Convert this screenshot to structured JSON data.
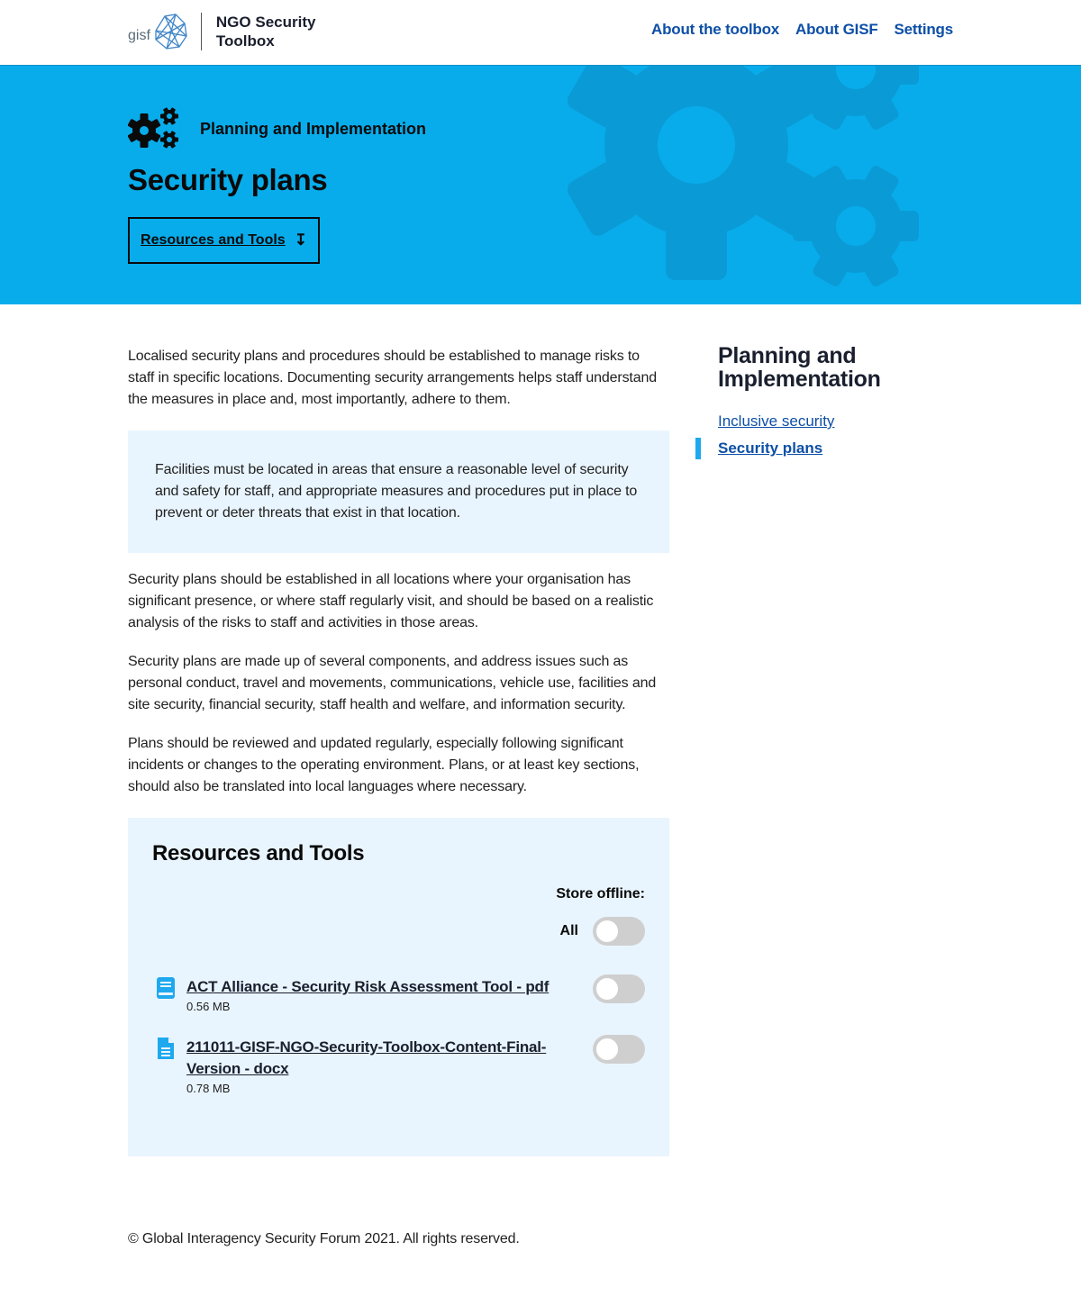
{
  "header": {
    "logo_text": "gisf",
    "site_title": "NGO Security Toolbox",
    "nav": [
      {
        "label": "About the toolbox"
      },
      {
        "label": "About GISF"
      },
      {
        "label": "Settings"
      }
    ]
  },
  "hero": {
    "category_icon": "gears-icon",
    "category": "Planning and Implementation",
    "title": "Security plans",
    "button_label": "Resources and Tools",
    "button_icon": "arrow-down-icon",
    "background_color": "#08aceb"
  },
  "main": {
    "intro": " Localised security plans and procedures should be established to manage risks to staff in specific locations.  Documenting security arrangements helps staff understand the measures in place and, most importantly, adhere to them.",
    "callout": "Facilities must be located in areas that ensure a reasonable level of security and safety for staff, and appropriate measures and procedures put in place to prevent or deter threats that exist in that location.",
    "paragraphs": [
      "Security plans should be established in all locations where your organisation has significant presence, or where staff regularly visit, and should be based on a realistic analysis of the risks to staff and activities in those areas.",
      " Security plans are made up of several components, and address issues such as personal conduct, travel and movements, communications, vehicle use, facilities and site security, financial security, staff health and welfare, and information security.",
      " Plans should be reviewed and updated regularly, especially following significant incidents or changes to the operating environment. Plans, or at least key sections, should also be translated into local languages where necessary."
    ]
  },
  "resources": {
    "title": "Resources and Tools",
    "store_offline_label": "Store offline:",
    "all_label": "All",
    "all_toggle_on": false,
    "items": [
      {
        "icon": "book-icon",
        "title": "ACT Alliance - Security Risk Assessment Tool - pdf",
        "size": "0.56 MB",
        "offline": false
      },
      {
        "icon": "document-icon",
        "title": "211011-GISF-NGO-Security-Toolbox-Content-Final-Version - docx",
        "size": "0.78 MB",
        "offline": false
      }
    ]
  },
  "sidebar": {
    "title": "Planning and Implementation",
    "items": [
      {
        "label": "Inclusive security",
        "active": false
      },
      {
        "label": "Security plans",
        "active": true
      }
    ]
  },
  "footer": {
    "copyright": "© Global Interagency Security Forum 2021. All rights reserved."
  }
}
